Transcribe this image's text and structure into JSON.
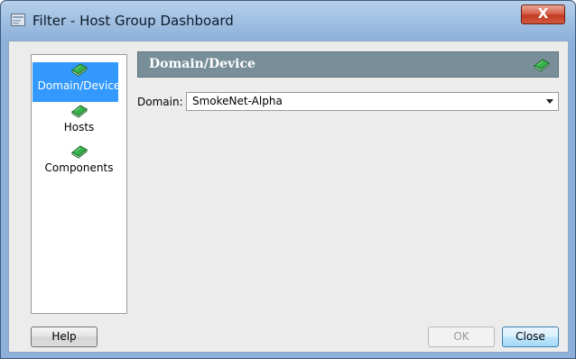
{
  "window": {
    "title": "Filter - Host Group Dashboard",
    "close_glyph": "X",
    "accent_color": "#3399ff"
  },
  "sidebar": {
    "items": [
      {
        "label": "Domain/Device",
        "icon": "book-icon",
        "selected": true
      },
      {
        "label": "Hosts",
        "icon": "book-icon",
        "selected": false
      },
      {
        "label": "Components",
        "icon": "book-icon",
        "selected": false
      }
    ]
  },
  "panel": {
    "title": "Domain/Device",
    "icon": "book-icon",
    "header_color": "#788f9a"
  },
  "domain": {
    "label": "Domain:",
    "value": "SmokeNet-Alpha"
  },
  "buttons": {
    "help": "Help",
    "ok": "OK",
    "close": "Close"
  }
}
